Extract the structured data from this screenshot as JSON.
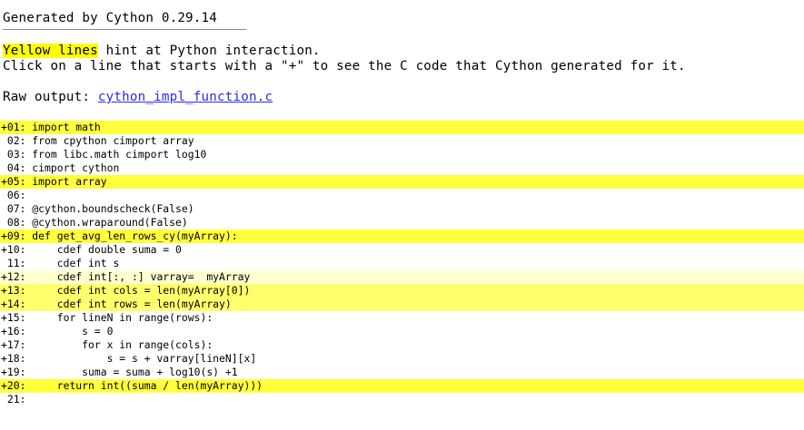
{
  "header": {
    "generated_by": "Generated by Cython 0.29.14",
    "hint_highlight": "Yellow lines",
    "hint_rest": " hint at Python interaction.",
    "click_hint": "Click on a line that starts with a \"+\" to see the C code that Cython generated for it.",
    "raw_output_label": "Raw output: ",
    "raw_output_link": "cython_impl_function.c"
  },
  "colors": {
    "no_interaction": "#ffffff",
    "light_interaction": "#ffffcf",
    "medium_interaction": "#ffff6e",
    "heavy_interaction": "#ffff3c",
    "hint_highlight": "#ffff00",
    "link": "#2a2ae6"
  },
  "code_lines": [
    {
      "prefix": "+01: ",
      "code": "import math",
      "level": 3,
      "expandable": true
    },
    {
      "prefix": " 02: ",
      "code": "from cpython cimport array",
      "level": 0,
      "expandable": false
    },
    {
      "prefix": " 03: ",
      "code": "from libc.math cimport log10",
      "level": 0,
      "expandable": false
    },
    {
      "prefix": " 04: ",
      "code": "cimport cython",
      "level": 0,
      "expandable": false
    },
    {
      "prefix": "+05: ",
      "code": "import array",
      "level": 3,
      "expandable": true
    },
    {
      "prefix": " 06: ",
      "code": "",
      "level": 0,
      "expandable": false
    },
    {
      "prefix": " 07: ",
      "code": "@cython.boundscheck(False)",
      "level": 0,
      "expandable": false
    },
    {
      "prefix": " 08: ",
      "code": "@cython.wraparound(False)",
      "level": 0,
      "expandable": false
    },
    {
      "prefix": "+09: ",
      "code": "def get_avg_len_rows_cy(myArray):",
      "level": 3,
      "expandable": true
    },
    {
      "prefix": "+10: ",
      "code": "    cdef double suma = 0",
      "level": 0,
      "expandable": true
    },
    {
      "prefix": " 11: ",
      "code": "    cdef int s",
      "level": 0,
      "expandable": false
    },
    {
      "prefix": "+12: ",
      "code": "    cdef int[:, :] varray=  myArray",
      "level": 1,
      "expandable": true
    },
    {
      "prefix": "+13: ",
      "code": "    cdef int cols = len(myArray[0])",
      "level": 2,
      "expandable": true
    },
    {
      "prefix": "+14: ",
      "code": "    cdef int rows = len(myArray)",
      "level": 2,
      "expandable": true
    },
    {
      "prefix": "+15: ",
      "code": "    for lineN in range(rows):",
      "level": 0,
      "expandable": true
    },
    {
      "prefix": "+16: ",
      "code": "        s = 0",
      "level": 0,
      "expandable": true
    },
    {
      "prefix": "+17: ",
      "code": "        for x in range(cols):",
      "level": 0,
      "expandable": true
    },
    {
      "prefix": "+18: ",
      "code": "            s = s + varray[lineN][x]",
      "level": 0,
      "expandable": true
    },
    {
      "prefix": "+19: ",
      "code": "        suma = suma + log10(s) +1",
      "level": 0,
      "expandable": true
    },
    {
      "prefix": "+20: ",
      "code": "    return int((suma / len(myArray)))",
      "level": 3,
      "expandable": true
    },
    {
      "prefix": " 21: ",
      "code": "",
      "level": 0,
      "expandable": false
    }
  ]
}
